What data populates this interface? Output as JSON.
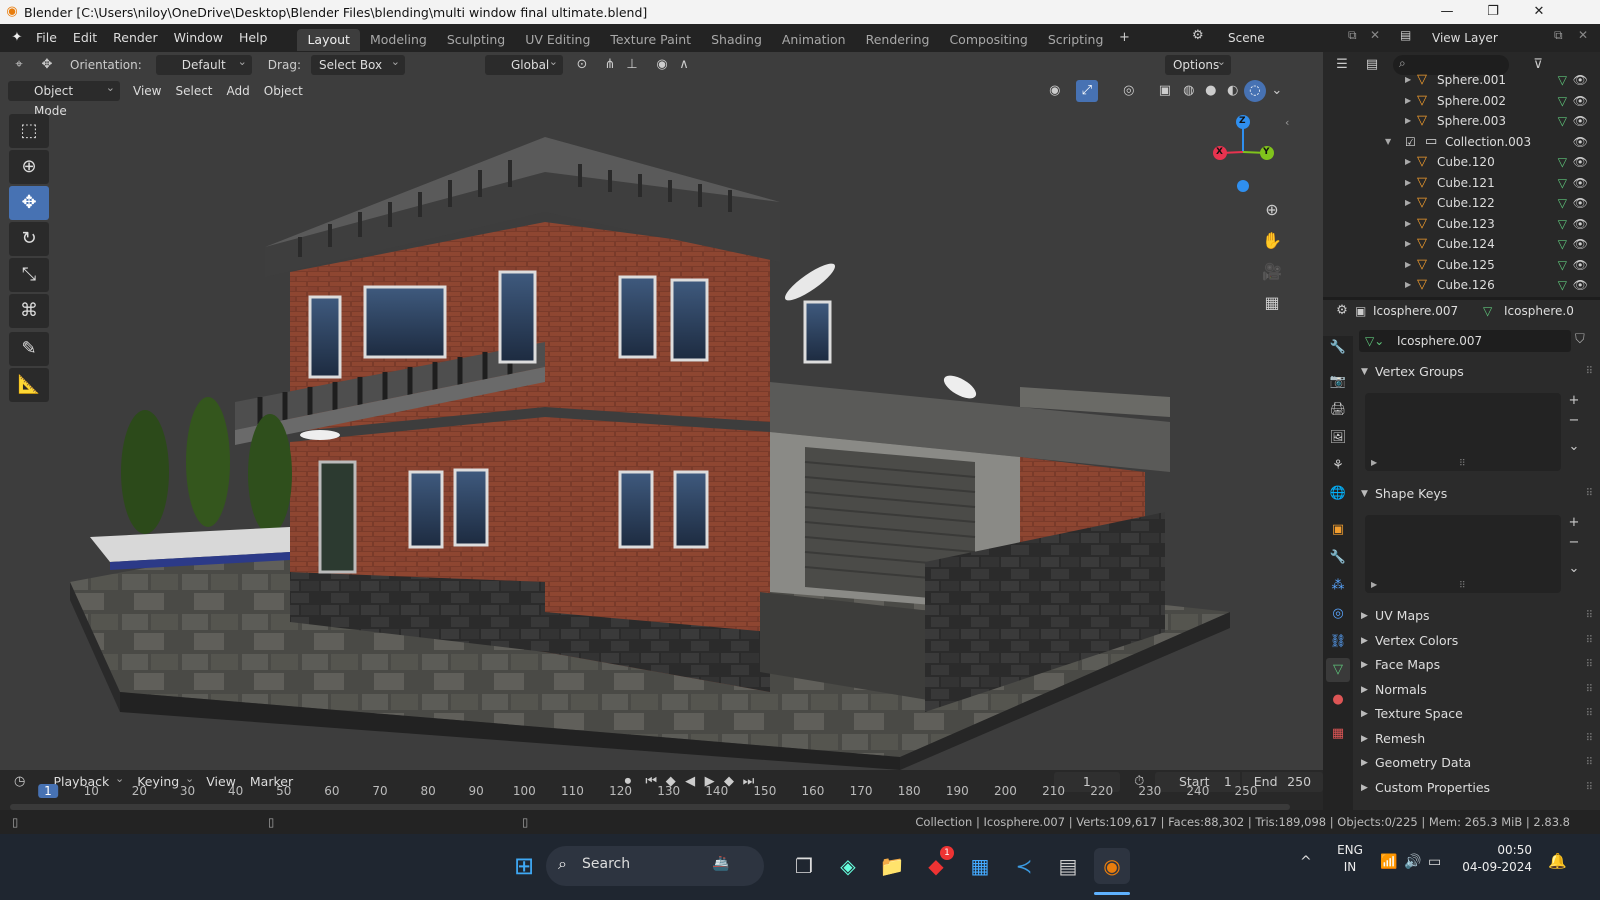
{
  "window": {
    "title": "Blender [C:\\Users\\niloy\\OneDrive\\Desktop\\Blender Files\\blending\\multi window final ultimate.blend]",
    "minimize": "—",
    "maximize": "❐",
    "close": "✕"
  },
  "menu": {
    "items": [
      "File",
      "Edit",
      "Render",
      "Window",
      "Help"
    ],
    "workspaces": [
      "Layout",
      "Modeling",
      "Sculpting",
      "UV Editing",
      "Texture Paint",
      "Shading",
      "Animation",
      "Rendering",
      "Compositing",
      "Scripting"
    ],
    "active_workspace": "Layout",
    "add_tab": "+",
    "scene": "Scene",
    "view_layer": "View Layer"
  },
  "viewport": {
    "orientation_label": "Orientation:",
    "orientation_value": "Default",
    "drag_label": "Drag:",
    "drag_value": "Select Box",
    "transform_space": "Global",
    "options": "Options",
    "mode": "Object Mode",
    "menus": [
      "View",
      "Select",
      "Add",
      "Object"
    ],
    "gizmo_axes": {
      "x": "X",
      "y": "Y",
      "z": "Z"
    },
    "colors": {
      "x": "#e8334f",
      "y": "#80c31c",
      "z": "#2f8fef",
      "active_tool": "#4772b3"
    }
  },
  "timeline": {
    "menus": [
      "Playback",
      "Keying",
      "View",
      "Marker"
    ],
    "current_frame": "1",
    "start_label": "Start",
    "start_value": "1",
    "end_label": "End",
    "end_value": "250",
    "ruler": [
      "1",
      "10",
      "20",
      "30",
      "40",
      "50",
      "60",
      "70",
      "80",
      "90",
      "100",
      "110",
      "120",
      "130",
      "140",
      "150",
      "160",
      "170",
      "180",
      "190",
      "200",
      "210",
      "220",
      "230",
      "240",
      "250"
    ]
  },
  "status": {
    "text": "Collection | Icosphere.007 | Verts:109,617 | Faces:88,302 | Tris:189,098 | Objects:0/225 | Mem: 265.3 MiB | 2.83.8"
  },
  "outliner": {
    "rows": [
      {
        "name": "Sphere.001",
        "type": "object",
        "indent": 2
      },
      {
        "name": "Sphere.002",
        "type": "object",
        "indent": 2
      },
      {
        "name": "Sphere.003",
        "type": "object",
        "indent": 2
      },
      {
        "name": "Collection.003",
        "type": "collection",
        "indent": 1
      },
      {
        "name": "Cube.120",
        "type": "object",
        "indent": 2
      },
      {
        "name": "Cube.121",
        "type": "object",
        "indent": 2
      },
      {
        "name": "Cube.122",
        "type": "object",
        "indent": 2
      },
      {
        "name": "Cube.123",
        "type": "object",
        "indent": 2
      },
      {
        "name": "Cube.124",
        "type": "object",
        "indent": 2
      },
      {
        "name": "Cube.125",
        "type": "object",
        "indent": 2
      },
      {
        "name": "Cube.126",
        "type": "object",
        "indent": 2
      }
    ]
  },
  "properties": {
    "object_name": "Icosphere.007",
    "data_name_crumb": "Icosphere.0",
    "mesh_name": "Icosphere.007",
    "panels": {
      "vertex_groups": "Vertex Groups",
      "shape_keys": "Shape Keys",
      "collapsed": [
        "UV Maps",
        "Vertex Colors",
        "Face Maps",
        "Normals",
        "Texture Space",
        "Remesh",
        "Geometry Data",
        "Custom Properties"
      ]
    }
  },
  "taskbar": {
    "search": "Search",
    "lang": "ENG",
    "region": "IN",
    "time": "00:50",
    "date": "04-09-2024",
    "badge": "1"
  }
}
